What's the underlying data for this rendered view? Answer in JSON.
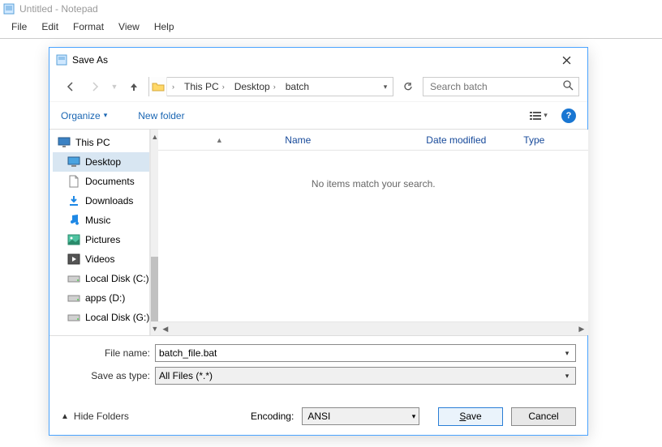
{
  "notepad": {
    "title": "Untitled - Notepad",
    "menus": [
      "File",
      "Edit",
      "Format",
      "View",
      "Help"
    ]
  },
  "dialog": {
    "title": "Save As",
    "search_placeholder": "Search batch",
    "breadcrumb": [
      "This PC",
      "Desktop",
      "batch"
    ],
    "organize_label": "Organize",
    "newfolder_label": "New folder",
    "columns": {
      "name": "Name",
      "date": "Date modified",
      "type": "Type"
    },
    "empty_message": "No items match your search.",
    "tree": [
      {
        "label": "This PC",
        "icon": "monitor"
      },
      {
        "label": "Desktop",
        "icon": "desktop",
        "selected": true,
        "indent": true
      },
      {
        "label": "Documents",
        "icon": "documents",
        "indent": true
      },
      {
        "label": "Downloads",
        "icon": "downloads",
        "indent": true
      },
      {
        "label": "Music",
        "icon": "music",
        "indent": true
      },
      {
        "label": "Pictures",
        "icon": "pictures",
        "indent": true
      },
      {
        "label": "Videos",
        "icon": "videos",
        "indent": true
      },
      {
        "label": "Local Disk (C:)",
        "icon": "disk",
        "indent": true
      },
      {
        "label": "apps (D:)",
        "icon": "disk",
        "indent": true
      },
      {
        "label": "Local Disk (G:)",
        "icon": "disk",
        "indent": true
      }
    ],
    "filename_label": "File name:",
    "filename_value": "batch_file.bat",
    "savetype_label": "Save as type:",
    "savetype_value": "All Files  (*.*)",
    "encoding_label": "Encoding:",
    "encoding_value": "ANSI",
    "hide_folders_label": "Hide Folders",
    "save_label": "Save",
    "cancel_label": "Cancel"
  }
}
